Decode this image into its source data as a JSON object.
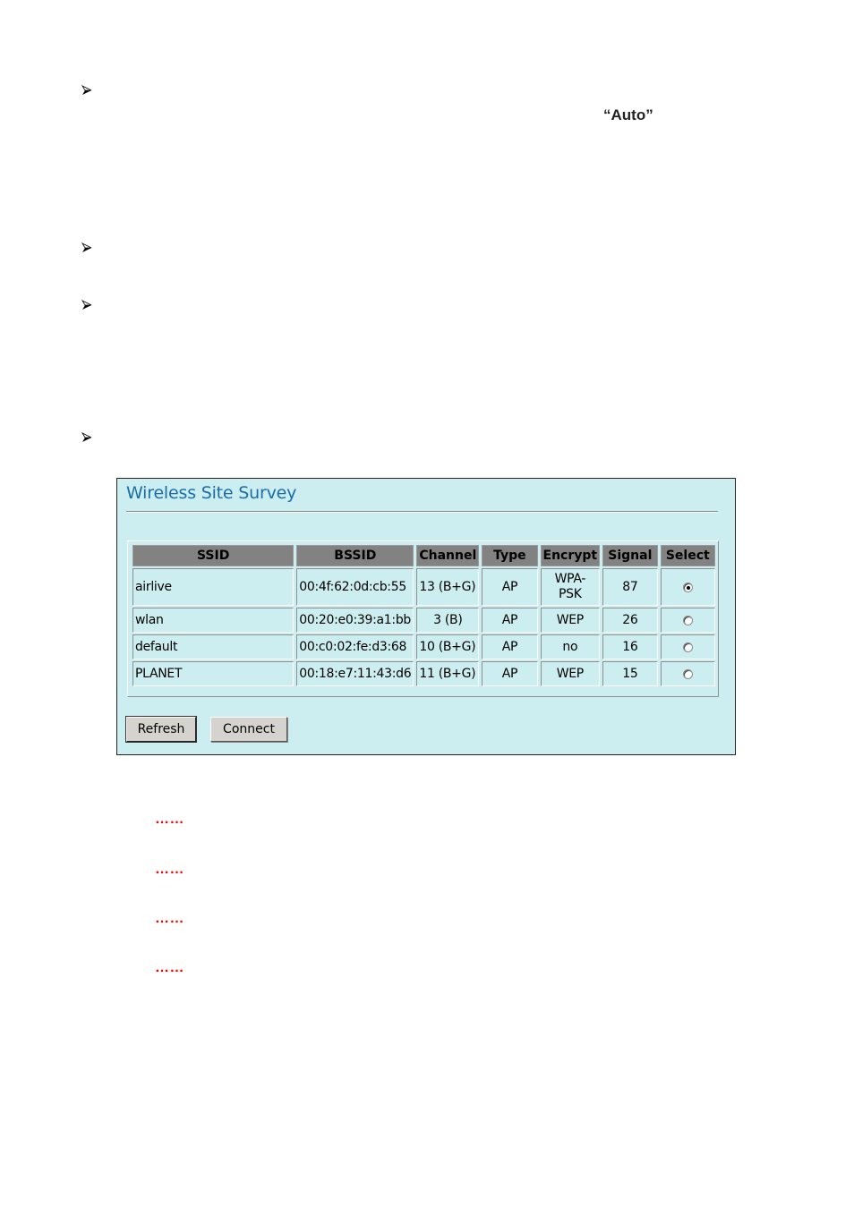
{
  "document": {
    "bullets": [
      {
        "icon": "arrowhead-bullet-icon"
      },
      {
        "icon": "arrowhead-bullet-icon"
      },
      {
        "icon": "arrowhead-bullet-icon"
      },
      {
        "icon": "arrowhead-bullet-icon"
      }
    ],
    "auto_text": "“Auto”",
    "ellipses": [
      "……",
      "……",
      "……",
      "……"
    ]
  },
  "survey": {
    "title": "Wireless Site Survey",
    "columns": [
      "SSID",
      "BSSID",
      "Channel",
      "Type",
      "Encrypt",
      "Signal",
      "Select"
    ],
    "rows": [
      {
        "ssid": "airlive",
        "bssid": "00:4f:62:0d:cb:55",
        "channel": "13 (B+G)",
        "type": "AP",
        "encrypt_line1": "WPA-",
        "encrypt_line2": "PSK",
        "signal": "87",
        "selected": true
      },
      {
        "ssid": "wlan",
        "bssid": "00:20:e0:39:a1:bb",
        "channel": "3 (B)",
        "type": "AP",
        "encrypt": "WEP",
        "signal": "26",
        "selected": false
      },
      {
        "ssid": "default",
        "bssid": "00:c0:02:fe:d3:68",
        "channel": "10 (B+G)",
        "type": "AP",
        "encrypt": "no",
        "signal": "16",
        "selected": false
      },
      {
        "ssid": "PLANET",
        "bssid": "00:18:e7:11:43:d6",
        "channel": "11 (B+G)",
        "type": "AP",
        "encrypt": "WEP",
        "signal": "15",
        "selected": false
      }
    ],
    "buttons": {
      "refresh": "Refresh",
      "connect": "Connect"
    },
    "colors": {
      "panel_bg": "#cdeef0",
      "title": "#1a6ea8",
      "header_bg": "#828282"
    }
  }
}
